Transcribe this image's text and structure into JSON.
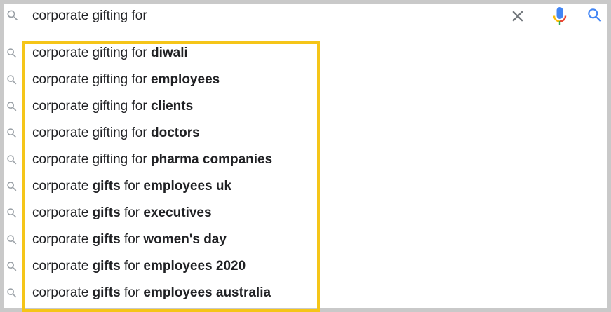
{
  "search": {
    "query": "corporate gifting for",
    "search_icon": "search-icon",
    "clear_icon": "close-icon",
    "mic_icon": "microphone-icon",
    "submit_icon": "search-icon"
  },
  "colors": {
    "highlight": "#f5c518",
    "mic_blue": "#4285f4",
    "mic_red": "#ea4335",
    "mic_yellow": "#fbbc05",
    "mic_green": "#34a853",
    "search_blue": "#4285f4",
    "icon_gray": "#9aa0a6"
  },
  "suggestions": [
    [
      {
        "t": "corporate gifting for ",
        "b": false
      },
      {
        "t": "diwali",
        "b": true
      }
    ],
    [
      {
        "t": "corporate gifting for ",
        "b": false
      },
      {
        "t": "employees",
        "b": true
      }
    ],
    [
      {
        "t": "corporate gifting for ",
        "b": false
      },
      {
        "t": "clients",
        "b": true
      }
    ],
    [
      {
        "t": "corporate gifting for ",
        "b": false
      },
      {
        "t": "doctors",
        "b": true
      }
    ],
    [
      {
        "t": "corporate gifting for ",
        "b": false
      },
      {
        "t": "pharma companies",
        "b": true
      }
    ],
    [
      {
        "t": "corporate ",
        "b": false
      },
      {
        "t": "gifts",
        "b": true
      },
      {
        "t": " for ",
        "b": false
      },
      {
        "t": "employees uk",
        "b": true
      }
    ],
    [
      {
        "t": "corporate ",
        "b": false
      },
      {
        "t": "gifts",
        "b": true
      },
      {
        "t": " for ",
        "b": false
      },
      {
        "t": "executives",
        "b": true
      }
    ],
    [
      {
        "t": "corporate ",
        "b": false
      },
      {
        "t": "gifts",
        "b": true
      },
      {
        "t": " for ",
        "b": false
      },
      {
        "t": "women's day",
        "b": true
      }
    ],
    [
      {
        "t": "corporate ",
        "b": false
      },
      {
        "t": "gifts",
        "b": true
      },
      {
        "t": " for ",
        "b": false
      },
      {
        "t": "employees 2020",
        "b": true
      }
    ],
    [
      {
        "t": "corporate ",
        "b": false
      },
      {
        "t": "gifts",
        "b": true
      },
      {
        "t": " for ",
        "b": false
      },
      {
        "t": "employees australia",
        "b": true
      }
    ]
  ]
}
